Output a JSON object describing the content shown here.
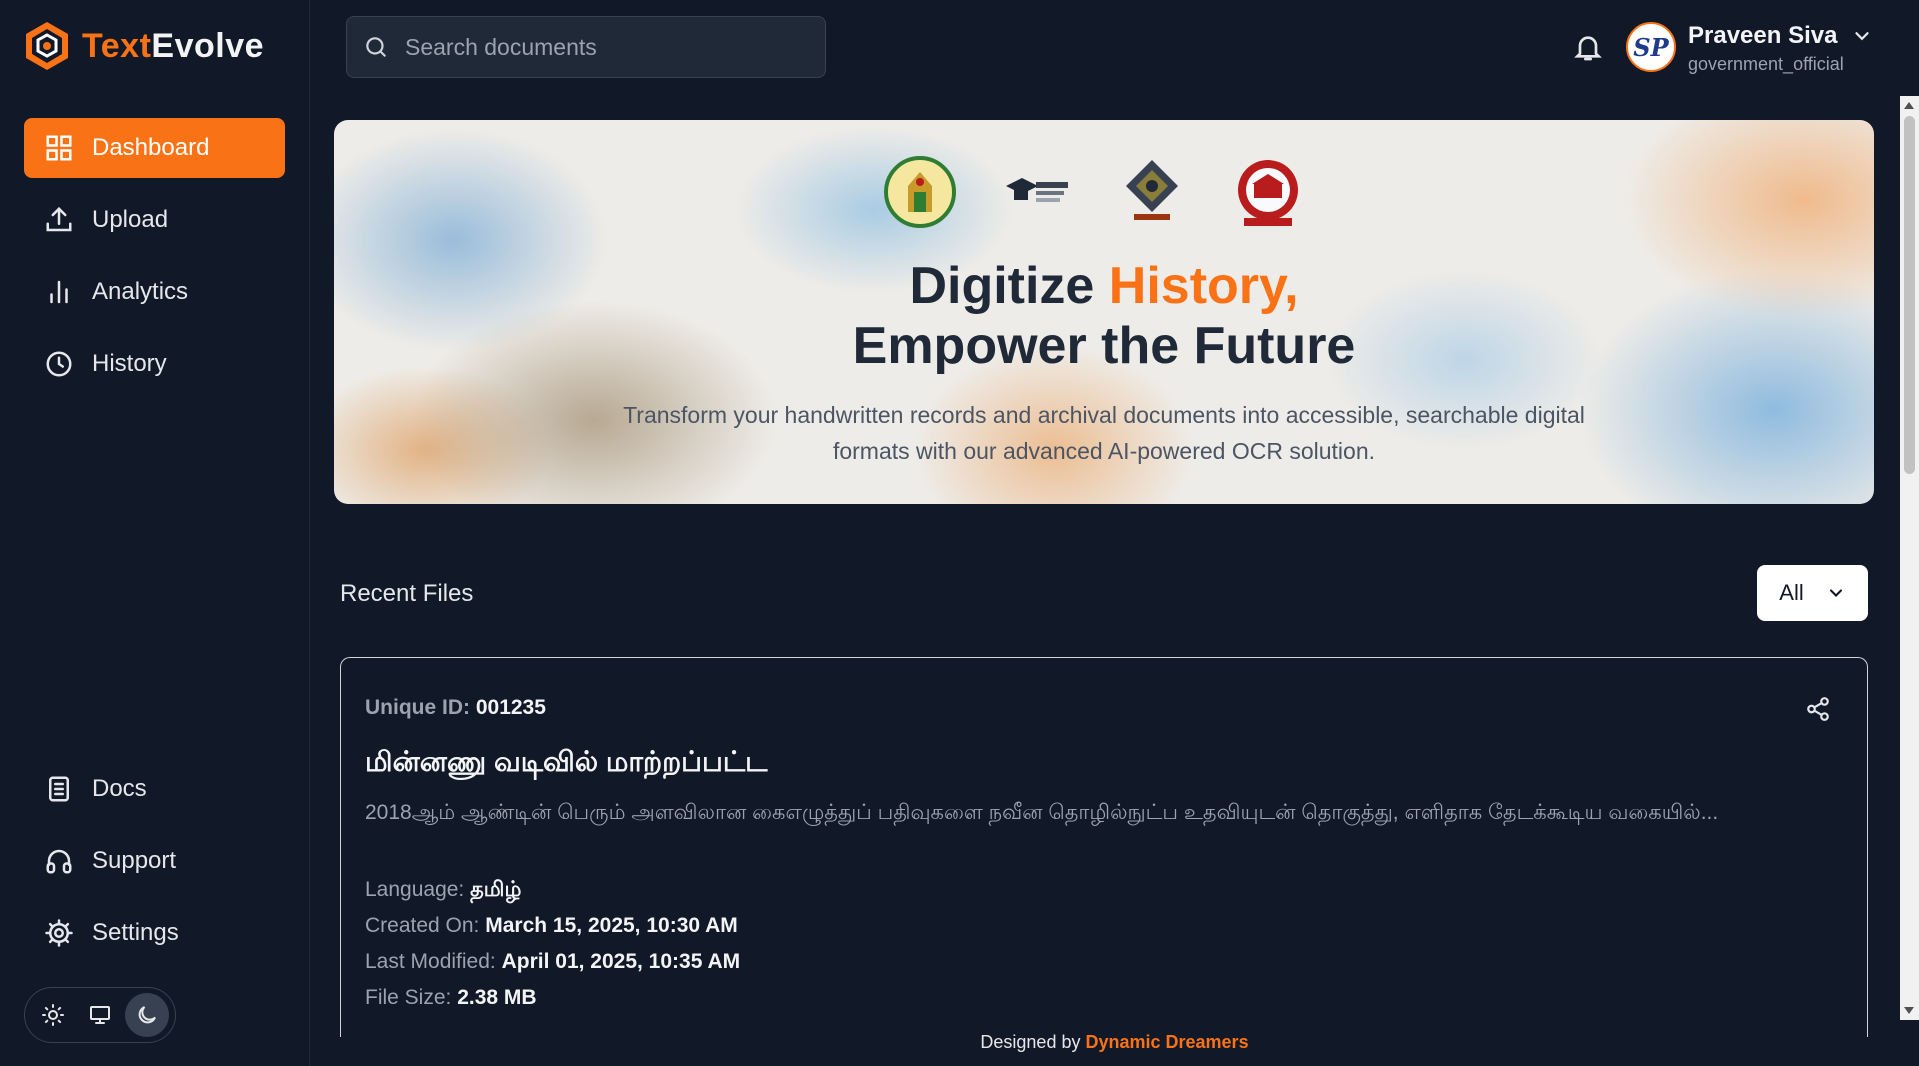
{
  "app": {
    "logo_part1": "Text",
    "logo_part2": "Evolve"
  },
  "sidebar": {
    "items": [
      {
        "label": "Dashboard",
        "icon": "grid-icon",
        "active": true
      },
      {
        "label": "Upload",
        "icon": "upload-icon"
      },
      {
        "label": "Analytics",
        "icon": "bar-chart-icon"
      },
      {
        "label": "History",
        "icon": "clock-icon"
      }
    ],
    "bottom_items": [
      {
        "label": "Docs",
        "icon": "document-icon"
      },
      {
        "label": "Support",
        "icon": "headphones-icon"
      },
      {
        "label": "Settings",
        "icon": "gear-icon"
      }
    ],
    "theme_options": [
      "light",
      "system",
      "dark"
    ],
    "theme_selected": "dark"
  },
  "search": {
    "placeholder": "Search documents",
    "value": ""
  },
  "user": {
    "name": "Praveen Siva",
    "role": "government_official",
    "avatar_initials": "SP"
  },
  "hero": {
    "title_part1": "Digitize ",
    "title_accent": "History,",
    "title_line2": "Empower the Future",
    "subtitle": "Transform your handwritten records and archival documents into accessible, searchable digital formats with our advanced AI-powered OCR solution."
  },
  "recent": {
    "title": "Recent Files",
    "filter_value": "All"
  },
  "card": {
    "uid_label": "Unique ID:",
    "uid_value": "001235",
    "title": "மின்னணு வடிவில் மாற்றப்பட்ட",
    "description": "2018ஆம் ஆண்டின் பெரும் அளவிலான கைஎழுத்துப் பதிவுகளை நவீன தொழில்நுட்ப உதவியுடன் தொகுத்து, எளிதாக தேடக்கூடிய வகையில்...",
    "language_label": "Language:",
    "language_value": "தமிழ்",
    "created_label": "Created On:",
    "created_value": "March 15, 2025, 10:30 AM",
    "modified_label": "Last Modified:",
    "modified_value": "April 01, 2025, 10:35 AM",
    "size_label": "File Size:",
    "size_value": "2.38 MB"
  },
  "footer": {
    "prefix": "Designed by ",
    "brand": "Dynamic Dreamers"
  },
  "colors": {
    "accent": "#f97316",
    "background": "#111827",
    "text": "#e5e7eb"
  }
}
